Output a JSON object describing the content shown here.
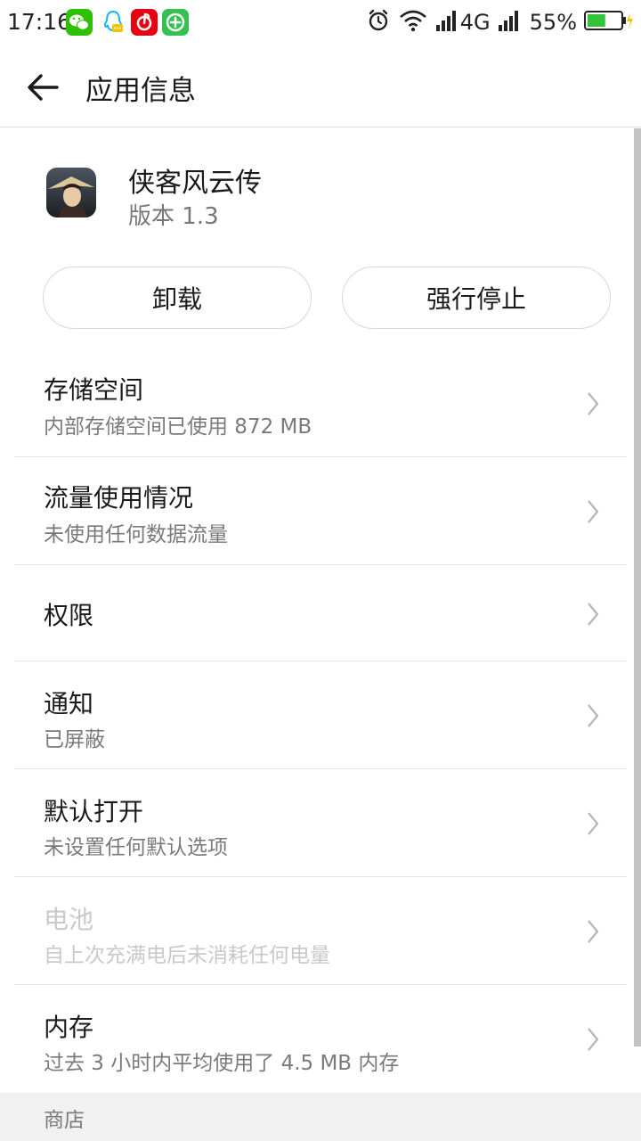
{
  "status_bar": {
    "time": "17:16",
    "network": "4G",
    "battery": "55%",
    "battery_level": 0.55,
    "apps": [
      "wechat-icon",
      "qq-icon",
      "netease-music-icon",
      "plus-app-icon"
    ]
  },
  "header": {
    "title": "应用信息"
  },
  "app": {
    "name": "侠客风云传",
    "version": "版本 1.3"
  },
  "actions": {
    "uninstall": "卸载",
    "force_stop": "强行停止"
  },
  "items": [
    {
      "title": "存储空间",
      "subtitle": "内部存储空间已使用 872 MB"
    },
    {
      "title": "流量使用情况",
      "subtitle": "未使用任何数据流量"
    },
    {
      "title": "权限",
      "subtitle": ""
    },
    {
      "title": "通知",
      "subtitle": "已屏蔽"
    },
    {
      "title": "默认打开",
      "subtitle": "未设置任何默认选项"
    },
    {
      "title": "电池",
      "subtitle": "自上次充满电后未消耗任何电量"
    },
    {
      "title": "内存",
      "subtitle": "过去 3 小时内平均使用了 4.5 MB 内存"
    }
  ],
  "section": {
    "store": "商店"
  },
  "colors": {
    "wechat": "#2dc100",
    "qq_chat": "#12b7f5",
    "netease": "#e60012",
    "plus_app": "#33c24f",
    "battery_fill": "#35c23b",
    "charging": "#f5c400"
  }
}
